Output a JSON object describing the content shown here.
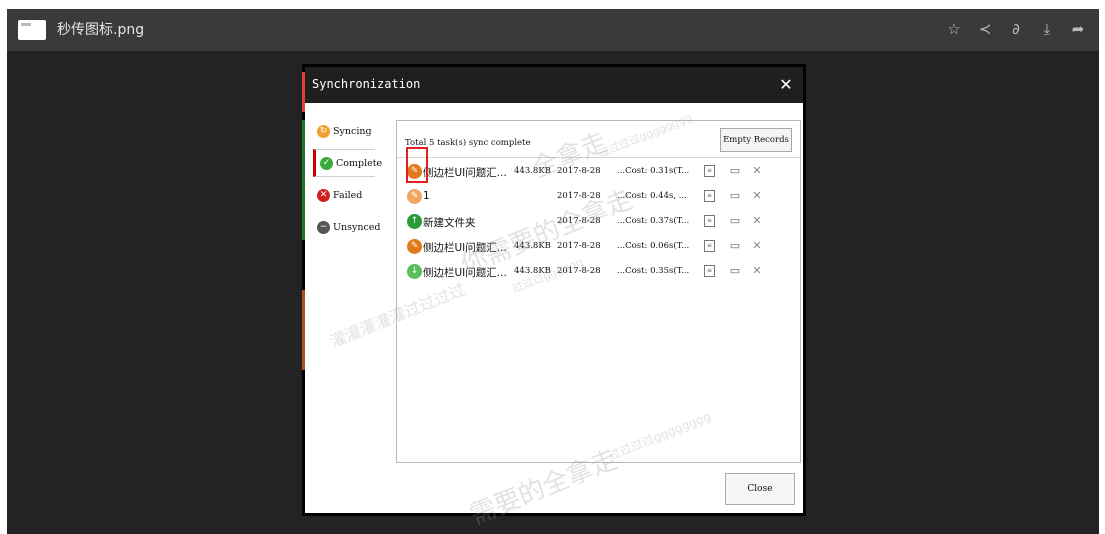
{
  "viewer": {
    "file_name": "秒传图标.png",
    "icons": [
      "star-icon",
      "share-icon",
      "link-icon",
      "download-icon",
      "forward-icon"
    ]
  },
  "dialog": {
    "title": "Synchronization",
    "tabs": [
      {
        "label": "Syncing",
        "icon": "sync-icon",
        "color": "#f0a030"
      },
      {
        "label": "Complete",
        "icon": "check-icon",
        "color": "#3aaa3a"
      },
      {
        "label": "Failed",
        "icon": "error-icon",
        "color": "#d02020"
      },
      {
        "label": "Unsynced",
        "icon": "minus-icon",
        "color": "#555555"
      }
    ],
    "summary": "Total 5 task(s) sync complete",
    "empty_records": "Empty Records",
    "rows": [
      {
        "name": "侧边栏UI问题汇...",
        "size": "443.8KB",
        "date": "2017-8-28",
        "cost": "...Cost: 0.31s(T...",
        "icon": "edit-icon",
        "color": "#e27a1b"
      },
      {
        "name": "1",
        "size": "",
        "date": "2017-8-28",
        "cost": "...Cost: 0.44s, ...",
        "icon": "edit-icon",
        "color": "#f0a860"
      },
      {
        "name": "新建文件夹",
        "size": "",
        "date": "2017-8-28",
        "cost": "...Cost: 0.37s(T...",
        "icon": "upload-icon",
        "color": "#2a9a3a"
      },
      {
        "name": "侧边栏UI问题汇...",
        "size": "443.8KB",
        "date": "2017-8-28",
        "cost": "...Cost: 0.06s(T...",
        "icon": "edit-icon",
        "color": "#e27a1b"
      },
      {
        "name": "侧边栏UI问题汇...",
        "size": "443.8KB",
        "date": "2017-8-28",
        "cost": "...Cost: 0.35s(T...",
        "icon": "download-icon",
        "color": "#5bbd5b"
      }
    ],
    "close_button": "Close",
    "watermarks": [
      "全拿走",
      "你需要的全拿走",
      "灌灌灌灌灌过过过过",
      "过过过过gggggggg",
      "过过过gggggg",
      "过过过过gggggggg",
      "需要的全拿走"
    ]
  }
}
